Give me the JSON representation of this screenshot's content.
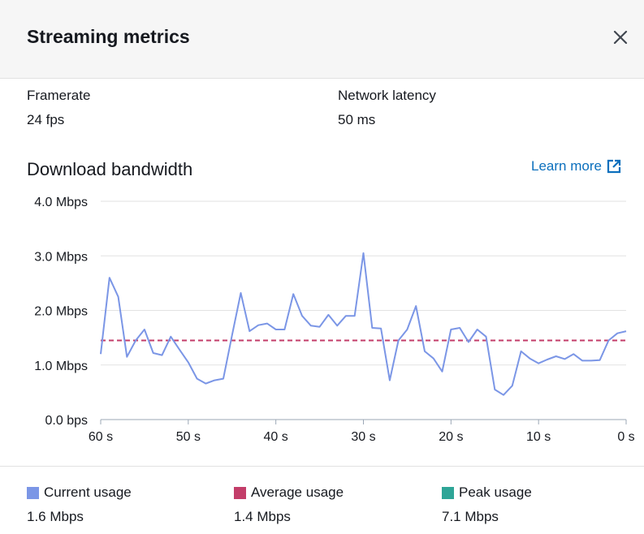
{
  "header": {
    "title": "Streaming metrics",
    "close_icon": "close-icon"
  },
  "metrics": [
    {
      "label": "Framerate",
      "value": "24 fps"
    },
    {
      "label": "Network latency",
      "value": "50 ms"
    }
  ],
  "bandwidth": {
    "title": "Download bandwidth",
    "learn_more": "Learn more",
    "learn_more_icon": "external-link-icon"
  },
  "chart_data": {
    "type": "line",
    "x": [
      60,
      59,
      58,
      57,
      56,
      55,
      54,
      53,
      52,
      51,
      50,
      49,
      48,
      47,
      46,
      45,
      44,
      43,
      42,
      41,
      40,
      39,
      38,
      37,
      36,
      35,
      34,
      33,
      32,
      31,
      30,
      29,
      28,
      27,
      26,
      25,
      24,
      23,
      22,
      21,
      20,
      19,
      18,
      17,
      16,
      15,
      14,
      13,
      12,
      11,
      10,
      9,
      8,
      7,
      6,
      5,
      4,
      3,
      2,
      1,
      0
    ],
    "series": [
      {
        "name": "Current usage",
        "color": "#7b96e6",
        "values": [
          1.2,
          2.6,
          2.25,
          1.15,
          1.45,
          1.65,
          1.22,
          1.18,
          1.52,
          1.28,
          1.05,
          0.75,
          0.66,
          0.72,
          0.75,
          1.55,
          2.32,
          1.62,
          1.73,
          1.76,
          1.65,
          1.65,
          2.3,
          1.9,
          1.72,
          1.7,
          1.92,
          1.72,
          1.9,
          1.9,
          3.05,
          1.68,
          1.67,
          0.72,
          1.45,
          1.65,
          2.08,
          1.25,
          1.12,
          0.88,
          1.65,
          1.68,
          1.42,
          1.65,
          1.52,
          0.55,
          0.45,
          0.62,
          1.25,
          1.12,
          1.03,
          1.1,
          1.16,
          1.11,
          1.2,
          1.08,
          1.08,
          1.09,
          1.45,
          1.58,
          1.62
        ]
      },
      {
        "name": "Average usage",
        "color": "#c33d69",
        "values": [
          1.45
        ]
      }
    ],
    "x_ticks": [
      "60 s",
      "50 s",
      "40 s",
      "30 s",
      "20 s",
      "10 s",
      "0 s"
    ],
    "y_ticks": [
      "0.0 bps",
      "1.0 Mbps",
      "2.0 Mbps",
      "3.0 Mbps",
      "4.0 Mbps"
    ],
    "xlim": [
      60,
      0
    ],
    "ylim": [
      0,
      4
    ],
    "grid": true
  },
  "legend": [
    {
      "label": "Current usage",
      "value": "1.6 Mbps",
      "color": "#7b96e6"
    },
    {
      "label": "Average usage",
      "value": "1.4 Mbps",
      "color": "#c33d69"
    },
    {
      "label": "Peak usage",
      "value": "7.1 Mbps",
      "color": "#2ea597"
    }
  ]
}
